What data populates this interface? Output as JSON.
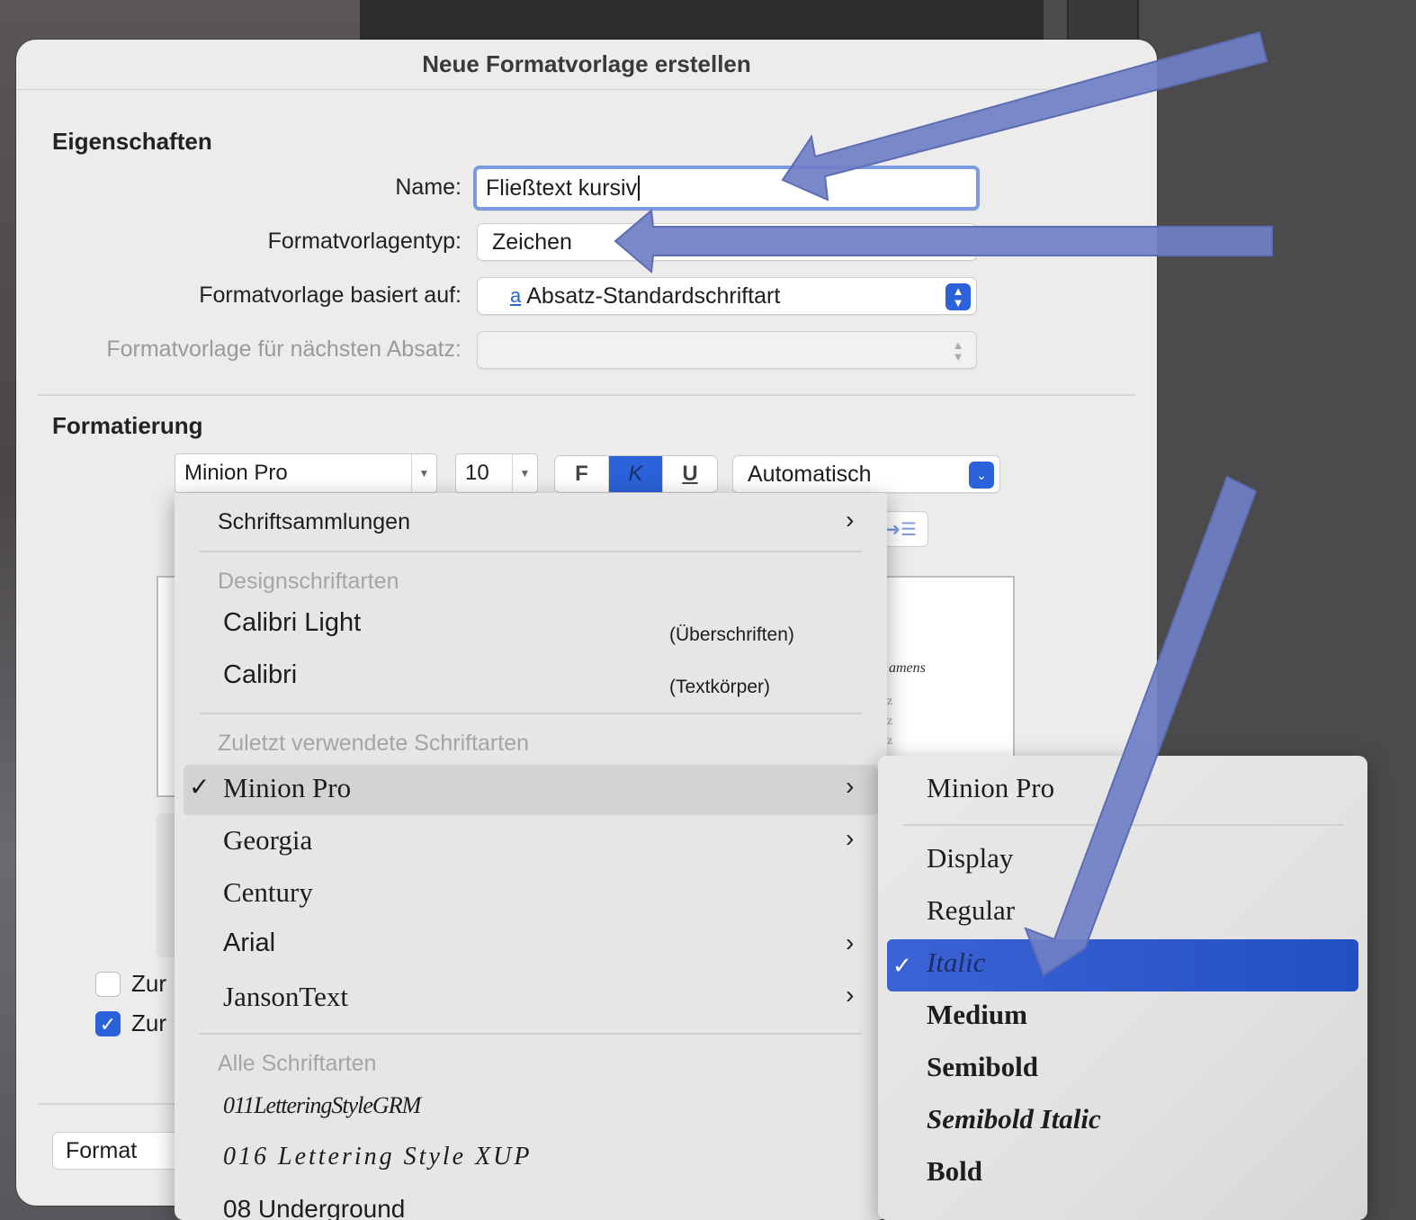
{
  "dialog": {
    "title": "Neue Formatvorlage erstellen"
  },
  "properties": {
    "heading": "Eigenschaften",
    "name_label": "Name:",
    "name_value": "Fließtext kursiv",
    "type_label": "Formatvorlagentyp:",
    "type_value": "Zeichen",
    "based_label": "Formatvorlage basiert auf:",
    "based_icon": "a",
    "based_value": "Absatz-Standardschriftart",
    "next_label": "Formatvorlage für nächsten Absatz:",
    "next_value": ""
  },
  "formatting": {
    "heading": "Formatierung",
    "font_value": "Minion Pro",
    "size_value": "10",
    "bold_label": "F",
    "italic_label": "K",
    "underline_label": "U",
    "color_value": "Automatisch"
  },
  "preview": {
    "snippet": "amens",
    "z1": "z",
    "z2": "z",
    "z3": "z"
  },
  "checkboxes": [
    {
      "label": "Zur",
      "checked": false
    },
    {
      "label": "Zur",
      "checked": true
    }
  ],
  "format_button": "Format",
  "font_menu": {
    "collections": "Schriftsammlungen",
    "theme_heading": "Designschriftarten",
    "theme_fonts": [
      {
        "name": "Calibri Light",
        "role": "(Überschriften)"
      },
      {
        "name": "Calibri",
        "role": "(Textkörper)"
      }
    ],
    "recent_heading": "Zuletzt verwendete Schriftarten",
    "recent_fonts": [
      "Minion Pro",
      "Georgia",
      "Century",
      "Arial",
      "JansonText"
    ],
    "all_heading": "Alle Schriftarten",
    "all_fonts": [
      "011LetteringStyleGRM",
      "016 Lettering Style XUP",
      "08 Underground"
    ]
  },
  "style_submenu": {
    "title": "Minion Pro",
    "styles": [
      "Display",
      "Regular",
      "Italic",
      "Medium",
      "Semibold",
      "Semibold Italic",
      "Bold"
    ],
    "selected": "Italic"
  },
  "colors": {
    "accent": "#2b62d9",
    "arrow": "#6f7fc4"
  }
}
